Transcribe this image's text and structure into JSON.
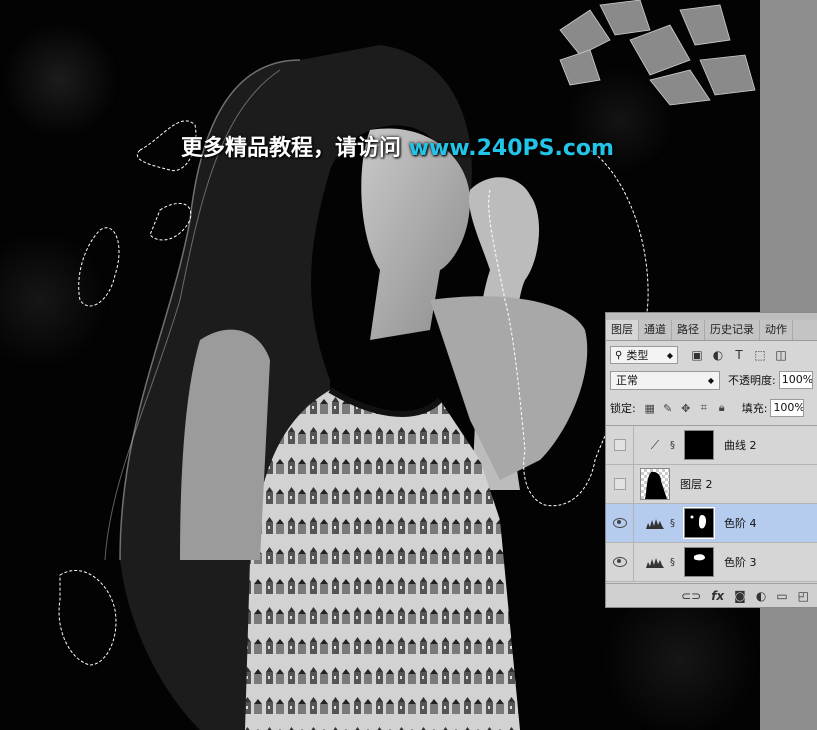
{
  "watermark": {
    "text_cn": "更多精品教程，请访问",
    "text_url": "www.240PS.com",
    "url_color": "#22c5e8"
  },
  "layers_panel": {
    "tabs": [
      "图层",
      "通道",
      "路径",
      "历史记录",
      "动作"
    ],
    "active_tab": "图层",
    "filter_kind": "类型",
    "blend_mode": "正常",
    "opacity_label": "不透明度:",
    "opacity_value": "100%",
    "lock_label": "锁定:",
    "fill_label": "填充:",
    "fill_value": "100%",
    "layers": [
      {
        "name": "曲线 2",
        "type": "curves",
        "visible": false,
        "selected": false,
        "icon": "curves-icon"
      },
      {
        "name": "图层 2",
        "type": "pixel",
        "visible": false,
        "selected": false,
        "icon": "pixel-thumbnail"
      },
      {
        "name": "色阶 4",
        "type": "levels",
        "visible": true,
        "selected": true,
        "icon": "levels-icon"
      },
      {
        "name": "色阶 3",
        "type": "levels",
        "visible": true,
        "selected": false,
        "icon": "levels-icon"
      }
    ],
    "bottom_icons": [
      "link-icon",
      "fx-icon",
      "mask-icon",
      "adjustment-icon",
      "folder-icon",
      "new-layer-icon",
      "trash-icon"
    ]
  }
}
